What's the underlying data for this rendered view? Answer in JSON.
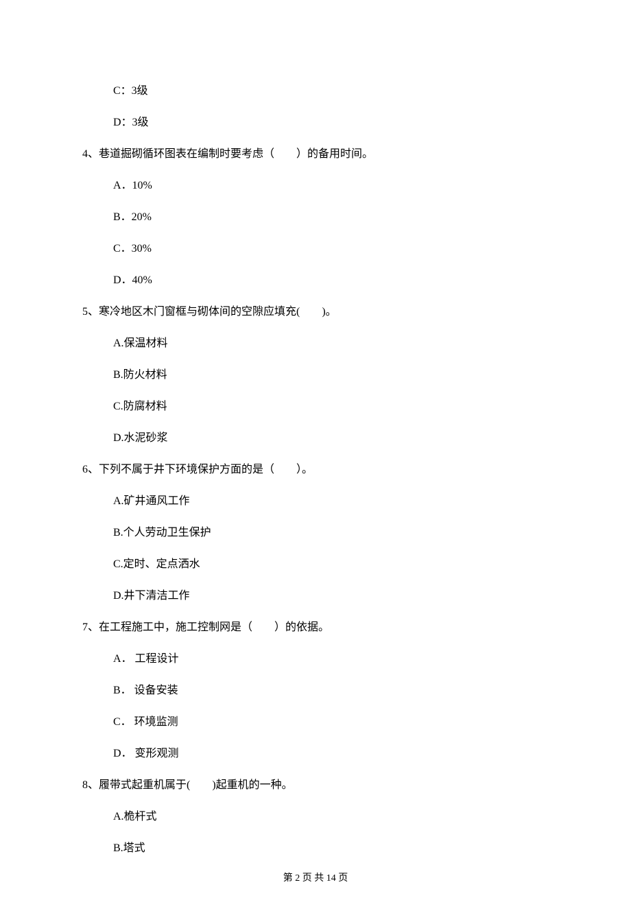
{
  "options_pre": [
    "C：3级",
    "D：3级"
  ],
  "questions": [
    {
      "stem": "4、巷道掘砌循环图表在编制时要考虑（　　）的备用时间。",
      "options": [
        "A．10%",
        "B．20%",
        "C．30%",
        "D．40%"
      ]
    },
    {
      "stem": "5、寒冷地区木门窗框与砌体间的空隙应填充(　　)。",
      "options": [
        "A.保温材料",
        "B.防火材料",
        "C.防腐材料",
        "D.水泥砂浆"
      ]
    },
    {
      "stem": "6、下列不属于井下环境保护方面的是（　　）。",
      "options": [
        "A.矿井通风工作",
        "B.个人劳动卫生保护",
        "C.定时、定点洒水",
        "D.井下清洁工作"
      ]
    },
    {
      "stem": "7、在工程施工中，施工控制网是（　　）的依据。",
      "options": [
        "A． 工程设计",
        "B． 设备安装",
        "C． 环境监测",
        "D． 变形观测"
      ]
    },
    {
      "stem": "8、履带式起重机属于(　　)起重机的一种。",
      "options": [
        "A.桅杆式",
        "B.塔式"
      ]
    }
  ],
  "footer": "第 2 页 共 14 页"
}
